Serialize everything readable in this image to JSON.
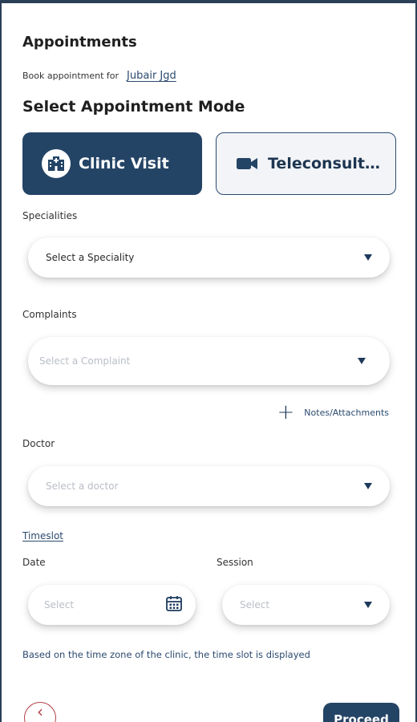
{
  "page": {
    "title": "Appointments",
    "book_for_label": "Book appointment for",
    "patient_name": "Jubair Jgd",
    "section_title": "Select Appointment Mode"
  },
  "modes": {
    "clinic": {
      "label": "Clinic Visit",
      "icon": "hospital-icon",
      "selected": true
    },
    "tele": {
      "label": "Teleconsultation",
      "icon": "video-camera-icon",
      "selected": false
    }
  },
  "form": {
    "speciality": {
      "label": "Specialities",
      "value": "Select a Speciality"
    },
    "complaints": {
      "label": "Complaints",
      "placeholder": "Select a Complaint"
    },
    "notes_label": "Notes/Attachments",
    "doctor": {
      "label": "Doctor",
      "placeholder": "Select a doctor"
    },
    "timeslot_label": "Timeslot",
    "date": {
      "label": "Date",
      "placeholder": "Select"
    },
    "session": {
      "label": "Session",
      "placeholder": "Select"
    },
    "timezone_note": "Based on the time zone of the clinic, the time slot is displayed"
  },
  "footer": {
    "back_icon": "chevron-left-icon",
    "proceed_label": "Proceed"
  },
  "colors": {
    "primary": "#244466",
    "link": "#2b4a6f",
    "back_accent": "#b04048"
  }
}
